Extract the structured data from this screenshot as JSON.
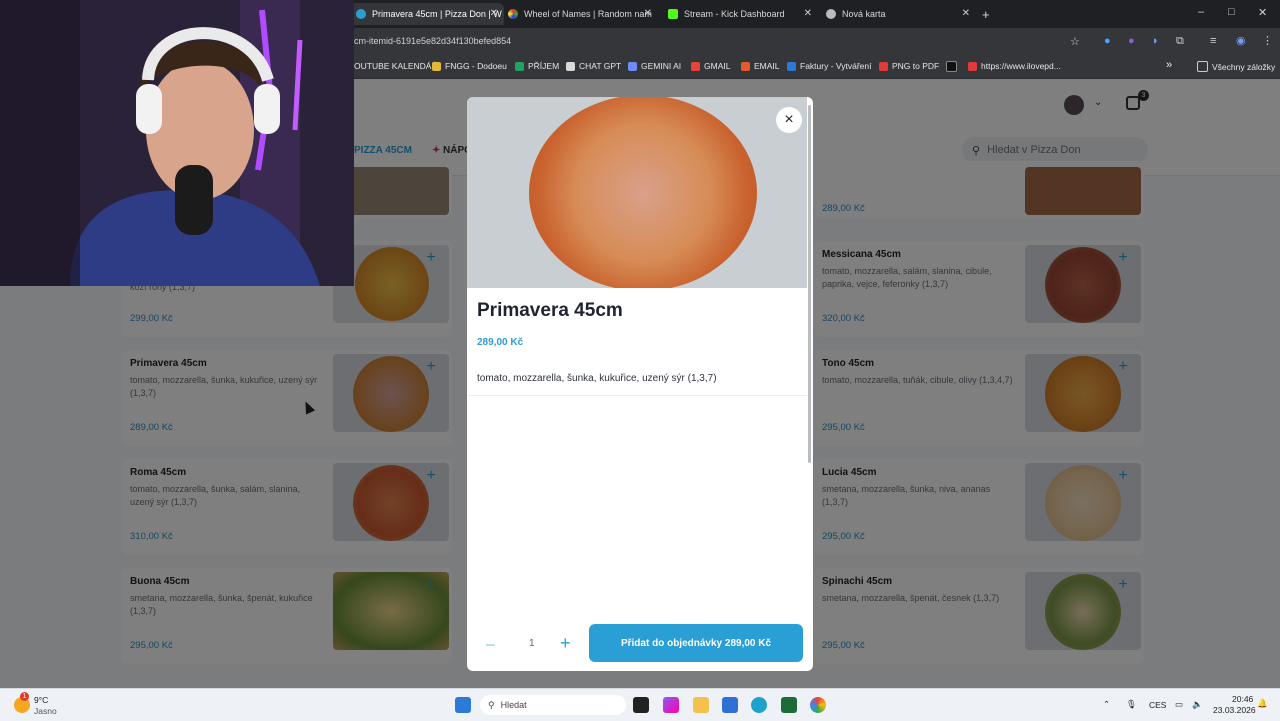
{
  "browser": {
    "tabs": [
      {
        "title": "Primavera 45cm | Pizza Don | W",
        "active": true
      },
      {
        "title": "Wheel of Names | Random nam",
        "active": false
      },
      {
        "title": "Stream - Kick Dashboard",
        "active": false
      },
      {
        "title": "Nová karta",
        "active": false
      }
    ],
    "new_tab": "+",
    "url": "cm-itemid-6191e5e82d34f130befed854",
    "bookmarks": [
      "OUTUBE KALENDÁŘ",
      "FNGG - Dodoeu",
      "PŘÍJEM",
      "CHAT GPT",
      "GEMINI AI",
      "GMAIL",
      "EMAIL",
      "Faktury - Vytváření",
      "PNG to PDF",
      "",
      "https://www.ilovepd..."
    ],
    "bookmarks_more": "»",
    "all_bookmarks": "Všechny záložky"
  },
  "site": {
    "categories": [
      "PIZZA 45CM",
      "NÁPO"
    ],
    "search_placeholder": "Hledat v Pizza Don",
    "cart_count": "3"
  },
  "menu_left": [
    {
      "name": "",
      "desc": "kozí rohy (1,3,7)",
      "price": "299,00 Kč"
    },
    {
      "name": "Primavera 45cm",
      "desc": "tomato, mozzarella, šunka, kukuřice, uzený sýr (1,3,7)",
      "price": "289,00 Kč"
    },
    {
      "name": "Roma 45cm",
      "desc": "tomato, mozzarella, šunka, salám, slanina, uzený sýr (1,3,7)",
      "price": "310,00 Kč"
    },
    {
      "name": "Buona 45cm",
      "desc": "smetana, mozzarella, šunka, špenát, kukuřice (1,3,7)",
      "price": "295,00 Kč"
    }
  ],
  "menu_right": [
    {
      "name": "",
      "desc": "",
      "price": "289,00 Kč"
    },
    {
      "name": "Messicana 45cm",
      "desc": "tomato, mozzarella, salám, slanina, cibule, paprika, vejce, feferonky (1,3,7)",
      "price": "320,00 Kč"
    },
    {
      "name": "Tono 45cm",
      "desc": "tomato, mozzarella, tuňák, cibule, olivy (1,3,4,7)",
      "price": "295,00 Kč"
    },
    {
      "name": "Lucia 45cm",
      "desc": "smetana, mozzarella, šunka, niva, ananas (1,3,7)",
      "price": "295,00 Kč"
    },
    {
      "name": "Spinachi 45cm",
      "desc": "smetana, mozzarella, špenát, česnek (1,3,7)",
      "price": "295,00 Kč"
    }
  ],
  "modal": {
    "title": "Primavera 45cm",
    "price": "289,00 Kč",
    "description": "tomato, mozzarella, šunka, kukuřice, uzený sýr (1,3,7)",
    "quantity": "1",
    "add_button": "Přidat do objednávky  289,00 Kč",
    "close": "×"
  },
  "taskbar": {
    "weather_temp": "9°C",
    "weather_text": "Jasno",
    "weather_badge": "1",
    "search": "Hledat",
    "lang": "CES",
    "time": "20:46",
    "date": "23.03.2026"
  },
  "colors": {
    "accent": "#2a9fd6",
    "overlay": "rgba(0,0,0,0.5)",
    "taskbar": "#eef1f6",
    "chrome": "#35363a"
  }
}
